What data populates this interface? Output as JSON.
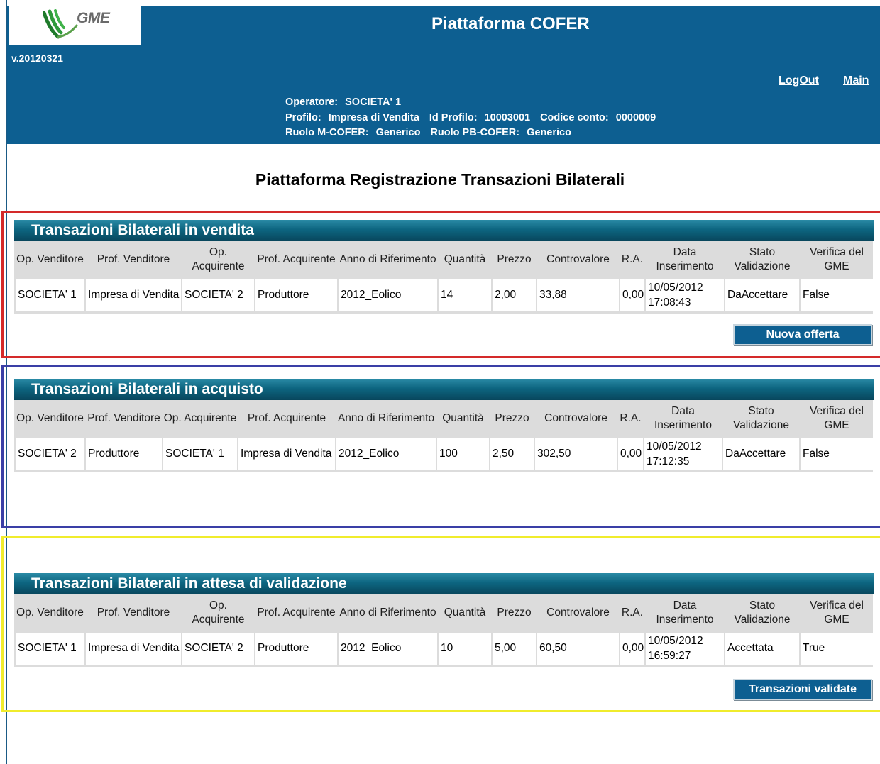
{
  "header": {
    "logo_text": "GME",
    "version": "v.20120321",
    "title": "Piattaforma COFER",
    "links": {
      "logout": "LogOut",
      "main": "Main"
    },
    "operator": {
      "operatore_label": "Operatore:",
      "operatore_value": "SOCIETA' 1",
      "profilo_label": "Profilo:",
      "profilo_value": "Impresa di Vendita",
      "id_profilo_label": "Id Profilo:",
      "id_profilo_value": "10003001",
      "codice_conto_label": "Codice conto:",
      "codice_conto_value": "0000009",
      "ruolo_mcofer_label": "Ruolo M-COFER:",
      "ruolo_mcofer_value": "Generico",
      "ruolo_pbcofer_label": "Ruolo PB-COFER:",
      "ruolo_pbcofer_value": "Generico"
    }
  },
  "page_title": "Piattaforma Registrazione Transazioni Bilaterali",
  "sections": {
    "vendita": {
      "title": "Transazioni Bilaterali in vendita",
      "headers": [
        "Op. Venditore",
        "Prof. Venditore",
        "Op. Acquirente",
        "Prof. Acquirente",
        "Anno di Riferimento",
        "Quantità",
        "Prezzo",
        "Controvalore",
        "R.A.",
        "Data Inserimento",
        "Stato Validazione",
        "Verifica del GME"
      ],
      "row": [
        "SOCIETA' 1",
        "Impresa di Vendita",
        "SOCIETA' 2",
        "Produttore",
        "2012_Eolico",
        "14",
        "2,00",
        "33,88",
        "0,00",
        "10/05/2012 17:08:43",
        "DaAccettare",
        "False"
      ],
      "button": "Nuova offerta"
    },
    "acquisto": {
      "title": "Transazioni Bilaterali in acquisto",
      "headers": [
        "Op. Venditore",
        "Prof. Venditore",
        "Op. Acquirente",
        "Prof. Acquirente",
        "Anno di Riferimento",
        "Quantità",
        "Prezzo",
        "Controvalore",
        "R.A.",
        "Data Inserimento",
        "Stato Validazione",
        "Verifica del GME"
      ],
      "row": [
        "SOCIETA' 2",
        "Produttore",
        "SOCIETA' 1",
        "Impresa di Vendita",
        "2012_Eolico",
        "100",
        "2,50",
        "302,50",
        "0,00",
        "10/05/2012 17:12:35",
        "DaAccettare",
        "False"
      ]
    },
    "attesa": {
      "title": "Transazioni Bilaterali in attesa di validazione",
      "headers": [
        "Op. Venditore",
        "Prof. Venditore",
        "Op. Acquirente",
        "Prof. Acquirente",
        "Anno di Riferimento",
        "Quantità",
        "Prezzo",
        "Controvalore",
        "R.A.",
        "Data Inserimento",
        "Stato Validazione",
        "Verifica del GME"
      ],
      "row": [
        "SOCIETA' 1",
        "Impresa di Vendita",
        "SOCIETA' 2",
        "Produttore",
        "2012_Eolico",
        "10",
        "5,00",
        "60,50",
        "0,00",
        "10/05/2012 16:59:27",
        "Accettata",
        "True"
      ],
      "button": "Transazioni validate"
    }
  },
  "colors": {
    "header_bg": "#0d5f91",
    "frame_vendita": "#d42a2a",
    "frame_acquisto": "#3a3fa6",
    "frame_attesa": "#f0ec2c",
    "logo_green": "#2e9a3a"
  }
}
